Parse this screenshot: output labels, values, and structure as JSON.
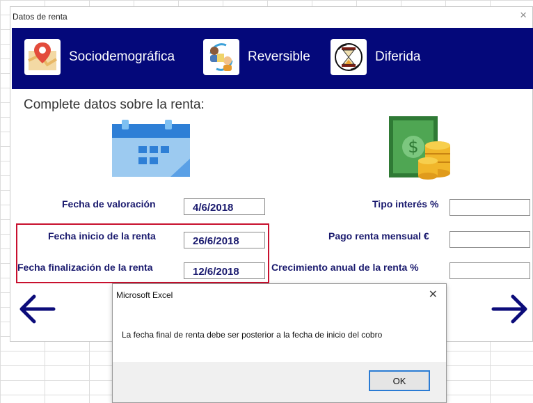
{
  "form": {
    "title": "Datos de renta",
    "close": "×",
    "tabs": [
      {
        "label": "Sociodemográfica",
        "icon": "map-pin-icon"
      },
      {
        "label": "Reversible",
        "icon": "people-exchange-icon"
      },
      {
        "label": "Diferida",
        "icon": "hourglass-icon"
      }
    ],
    "section_title": "Complete datos sobre la renta:",
    "left_fields": [
      {
        "label": "Fecha de valoración",
        "value": "4/6/2018"
      },
      {
        "label": "Fecha inicio de la renta",
        "value": "26/6/2018"
      },
      {
        "label": "Fecha finalización de la renta",
        "value": "12/6/2018"
      }
    ],
    "right_fields": [
      {
        "label": "Tipo interés %",
        "value": ""
      },
      {
        "label": "Pago renta mensual €",
        "value": ""
      },
      {
        "label": "Crecimiento anual de la renta %",
        "value": ""
      }
    ],
    "colors": {
      "banner": "#04087a",
      "highlight": "#c8102e",
      "arrows": "#0c0c7a"
    }
  },
  "dialog": {
    "title": "Microsoft Excel",
    "close": "✕",
    "message": "La fecha final de renta debe ser posterior a la fecha de inicio del cobro",
    "ok_label": "OK"
  }
}
